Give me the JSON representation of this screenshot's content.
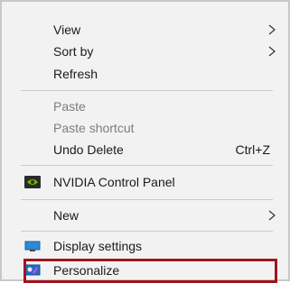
{
  "context_menu": {
    "items": [
      {
        "label": "View",
        "has_submenu": true
      },
      {
        "label": "Sort by",
        "has_submenu": true
      },
      {
        "label": "Refresh"
      },
      {
        "label": "Paste",
        "disabled": true
      },
      {
        "label": "Paste shortcut",
        "disabled": true
      },
      {
        "label": "Undo Delete",
        "shortcut": "Ctrl+Z"
      },
      {
        "label": "NVIDIA Control Panel",
        "icon": "nvidia-icon"
      },
      {
        "label": "New",
        "has_submenu": true
      },
      {
        "label": "Display settings",
        "icon": "display-icon"
      },
      {
        "label": "Personalize",
        "icon": "personalize-icon",
        "highlighted": true
      }
    ]
  },
  "colors": {
    "menu_background": "#f2f2f2",
    "highlight_border": "#a0141e",
    "disabled_text": "#7d7d7d",
    "nvidia_green": "#76b900"
  }
}
